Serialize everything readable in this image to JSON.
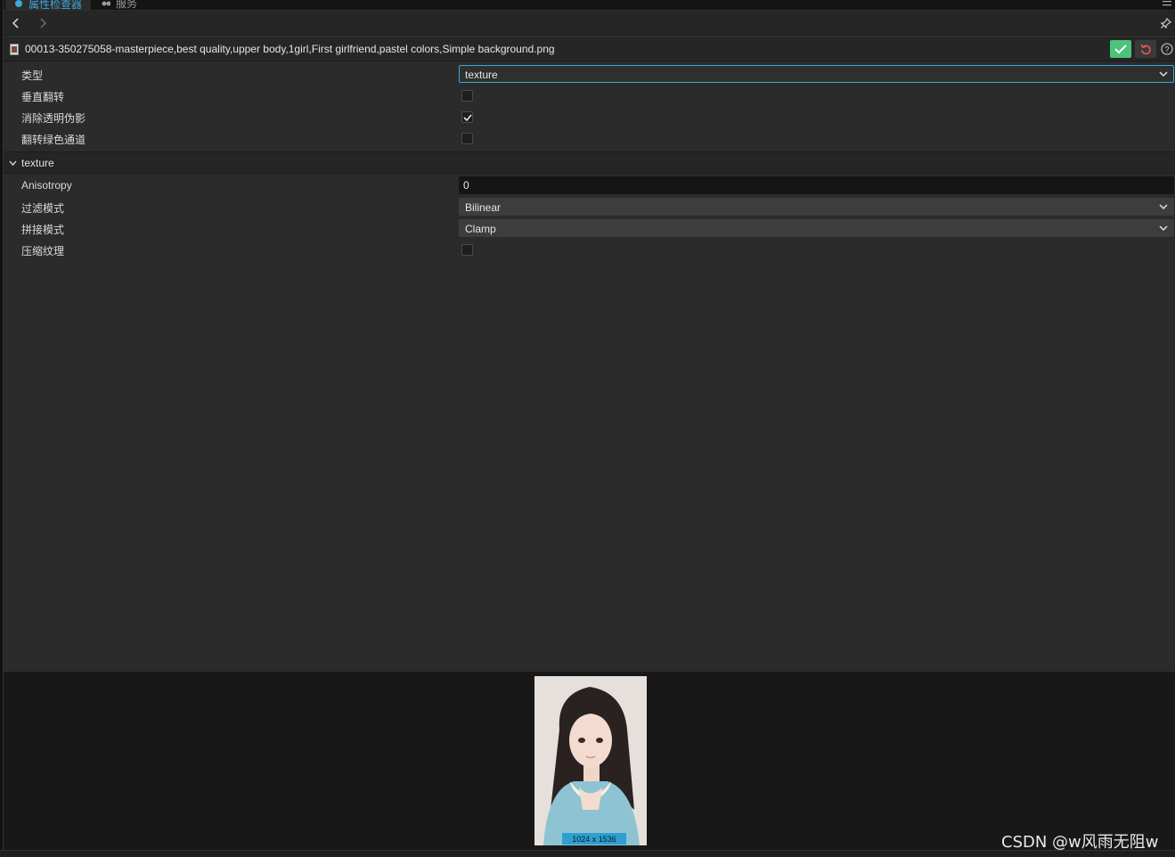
{
  "tabs": [
    {
      "label": "属性检查器",
      "active": true,
      "icon": "inspector-icon"
    },
    {
      "label": "服务",
      "active": false,
      "icon": "services-icon"
    }
  ],
  "file": {
    "name": "00013-350275058-masterpiece,best quality,upper body,1girl,First girlfriend,pastel colors,Simple background.png",
    "icon": "image-file-icon"
  },
  "properties": {
    "type": {
      "label": "类型",
      "value": "texture"
    },
    "flip_vertical": {
      "label": "垂直翻转",
      "checked": false
    },
    "remove_transparency": {
      "label": "消除透明伪影",
      "checked": true
    },
    "flip_green": {
      "label": "翻转绿色通道",
      "checked": false
    }
  },
  "texture_section": {
    "title": "texture",
    "anisotropy": {
      "label": "Anisotropy",
      "value": "0"
    },
    "filter_mode": {
      "label": "过滤模式",
      "value": "Bilinear"
    },
    "wrap_mode": {
      "label": "拼接模式",
      "value": "Clamp"
    },
    "compress": {
      "label": "压缩纹理",
      "checked": false
    }
  },
  "preview": {
    "dimensions": "1024 x 1536"
  },
  "watermark": "CSDN @w风雨无阻w",
  "colors": {
    "accent": "#3fa6d8",
    "apply": "#4cc27a",
    "revert": "#e05a5a",
    "panel": "#2b2b2b"
  }
}
